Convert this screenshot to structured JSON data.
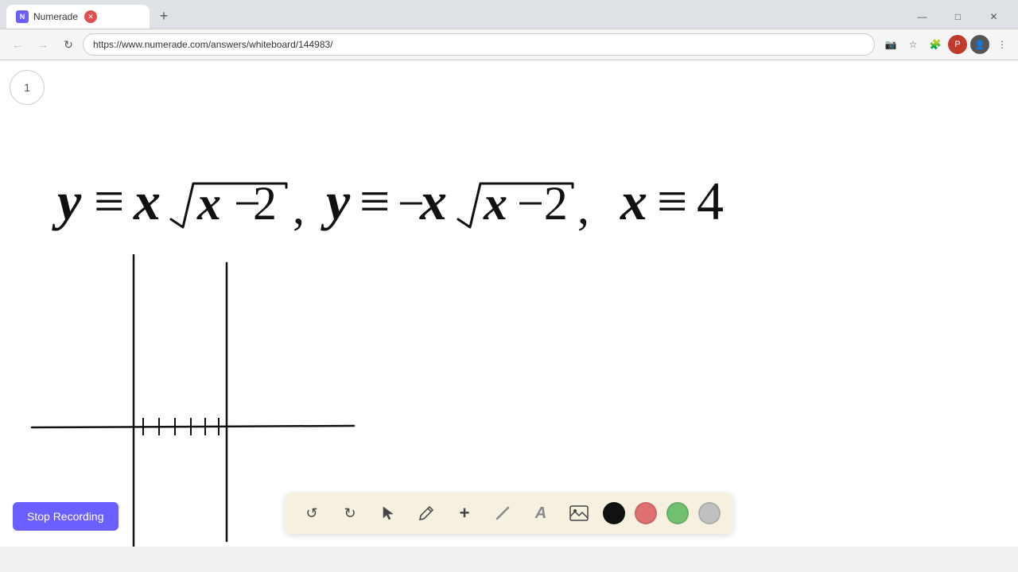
{
  "browser": {
    "tab_title": "Numerade",
    "url": "https://www.numerade.com/answers/whiteboard/144983/",
    "new_tab_label": "+",
    "window_controls": {
      "minimize": "—",
      "maximize": "□",
      "close": "✕"
    }
  },
  "nav": {
    "back_label": "←",
    "forward_label": "→",
    "refresh_label": "↻",
    "url": "https://www.numerade.com/answers/whiteboard/144983/"
  },
  "whiteboard": {
    "page_number": "1",
    "math_text": "y = x√(x−2), y = −x√(x−2), x = 4"
  },
  "toolbar": {
    "undo_label": "↺",
    "redo_label": "↻",
    "select_label": "▶",
    "pen_label": "✏",
    "plus_label": "+",
    "eraser_label": "/",
    "text_label": "A",
    "image_label": "🖼",
    "colors": [
      "#111111",
      "#e07070",
      "#70c070",
      "#c0c0c0"
    ]
  },
  "stop_recording": {
    "label": "Stop Recording"
  }
}
